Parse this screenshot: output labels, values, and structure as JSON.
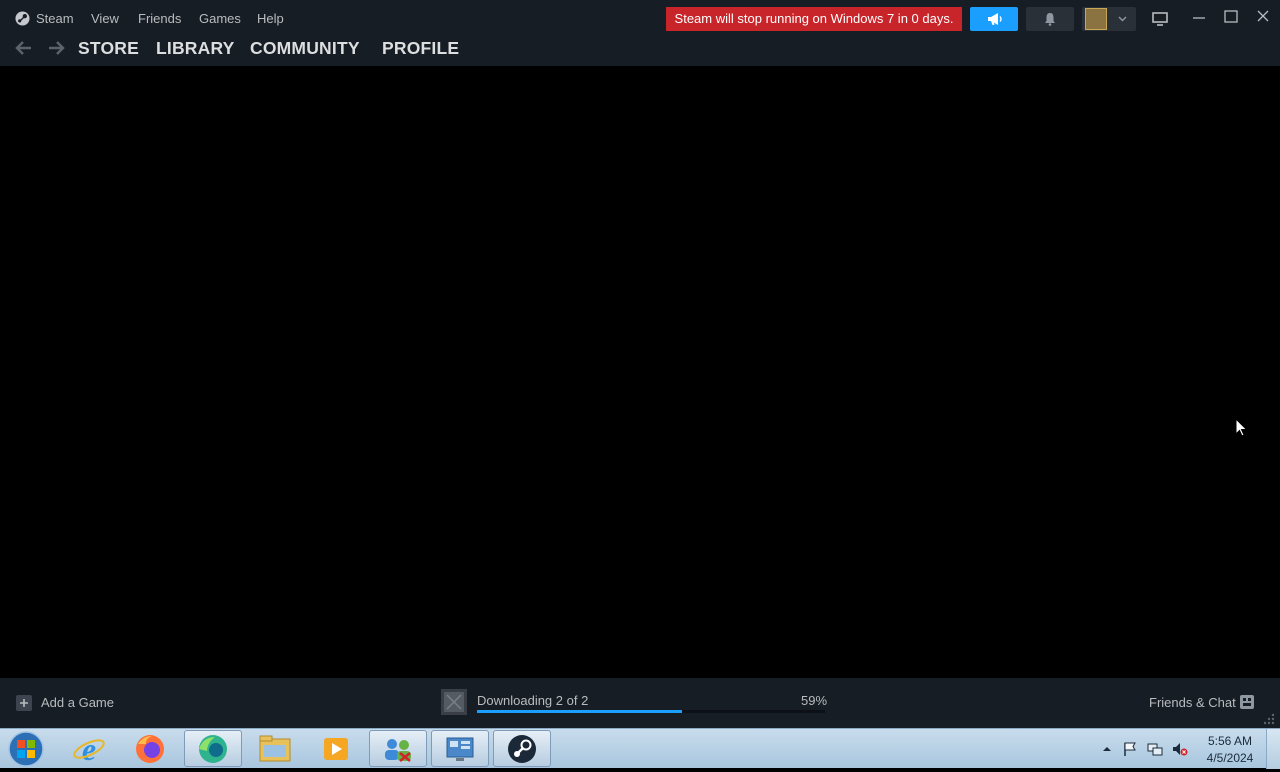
{
  "window": {
    "menu": [
      "Steam",
      "View",
      "Friends",
      "Games",
      "Help"
    ],
    "nav_links": [
      "STORE",
      "LIBRARY",
      "COMMUNITY",
      "PROFILE"
    ],
    "warning_banner": "Steam will stop running on Windows 7 in 0 days.",
    "icons": [
      "steam-logo-icon",
      "back-arrow-icon",
      "forward-arrow-icon",
      "megaphone-icon",
      "bell-icon",
      "chevron-down-icon",
      "monitor-icon",
      "minimize-icon",
      "maximize-icon",
      "close-icon"
    ]
  },
  "bottom_bar": {
    "add_game": "Add a Game",
    "download_status": "Downloading 2 of 2",
    "download_percent_label": "59%",
    "download_progress": 0.59,
    "friends_chat": "Friends & Chat"
  },
  "taskbar": {
    "apps": [
      "start-orb",
      "internet-explorer",
      "firefox",
      "edge-like-app",
      "file-explorer",
      "media-player",
      "users-app",
      "control-panel",
      "steam"
    ],
    "time": "5:56 AM",
    "date": "4/5/2024"
  },
  "colors": {
    "accent": "#1a9fff",
    "warning": "#c8252a",
    "chrome": "#171d25"
  }
}
